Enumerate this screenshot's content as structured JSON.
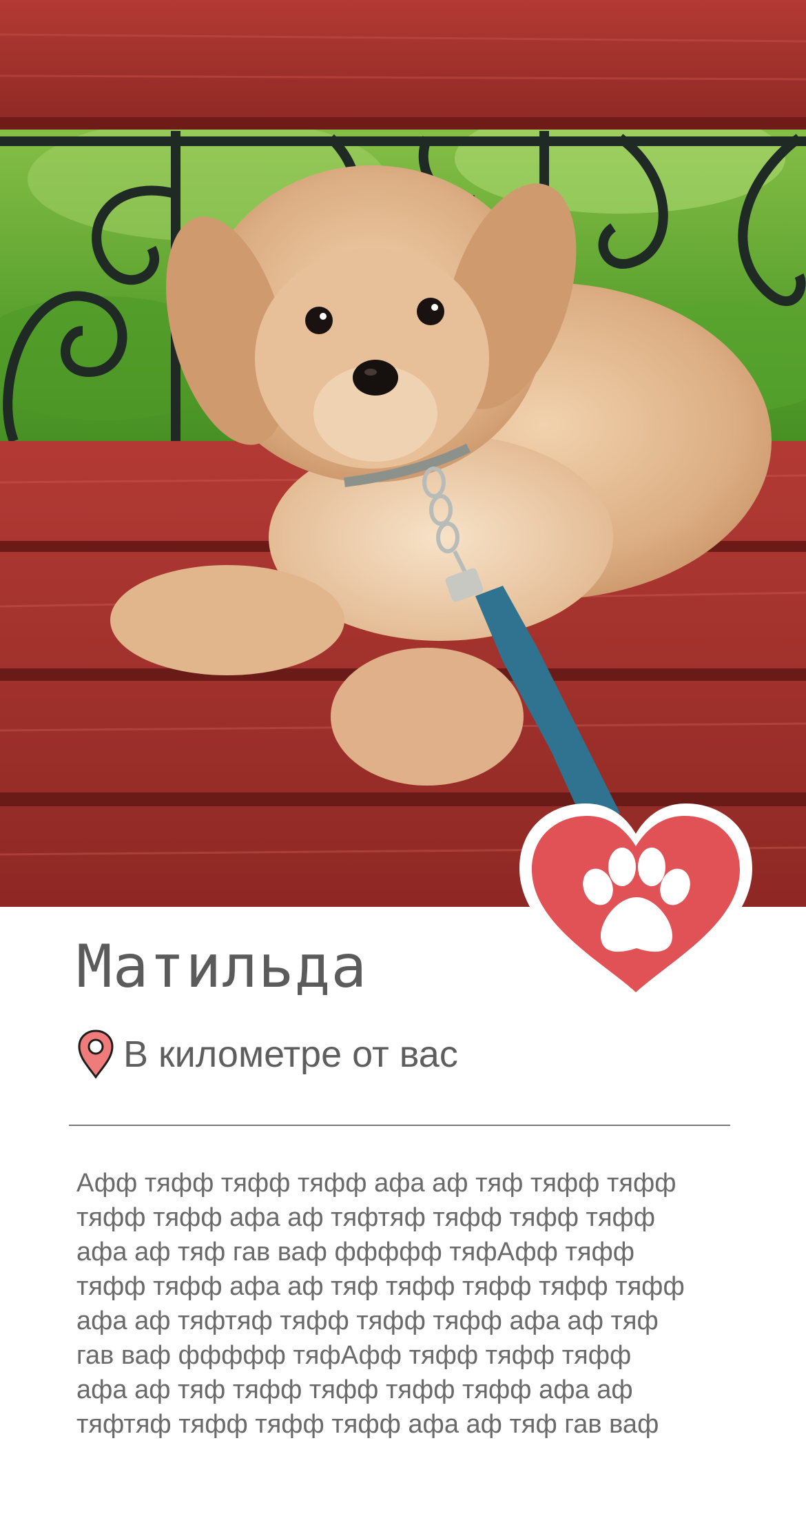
{
  "pet": {
    "name": "Матильда",
    "location": "В километре от вас",
    "description_lines": [
      "Афф тяфф тяфф тяфф афа аф тяф тяфф тяфф",
      "тяфф тяфф афа аф тяфтяф тяфф тяфф тяфф",
      "афа аф тяф гав ваф ффффф тяфАфф тяфф",
      "тяфф тяфф афа аф тяф тяфф тяфф тяфф тяфф",
      "афа аф тяфтяф тяфф тяфф тяфф афа аф тяф",
      "гав ваф ффффф тяфАфф тяфф тяфф тяфф",
      "афа аф тяф тяфф тяфф тяфф тяфф афа аф",
      "тяфтяф тяфф тяфф тяфф афа аф тяф гав ваф"
    ]
  },
  "icons": {
    "favorite": "heart-paw-icon",
    "location": "map-pin-icon",
    "photo": "dog-photo"
  },
  "colors": {
    "accent": "#e05256",
    "text": "#5b5b5b",
    "divider": "#777777",
    "background": "#ffffff"
  }
}
